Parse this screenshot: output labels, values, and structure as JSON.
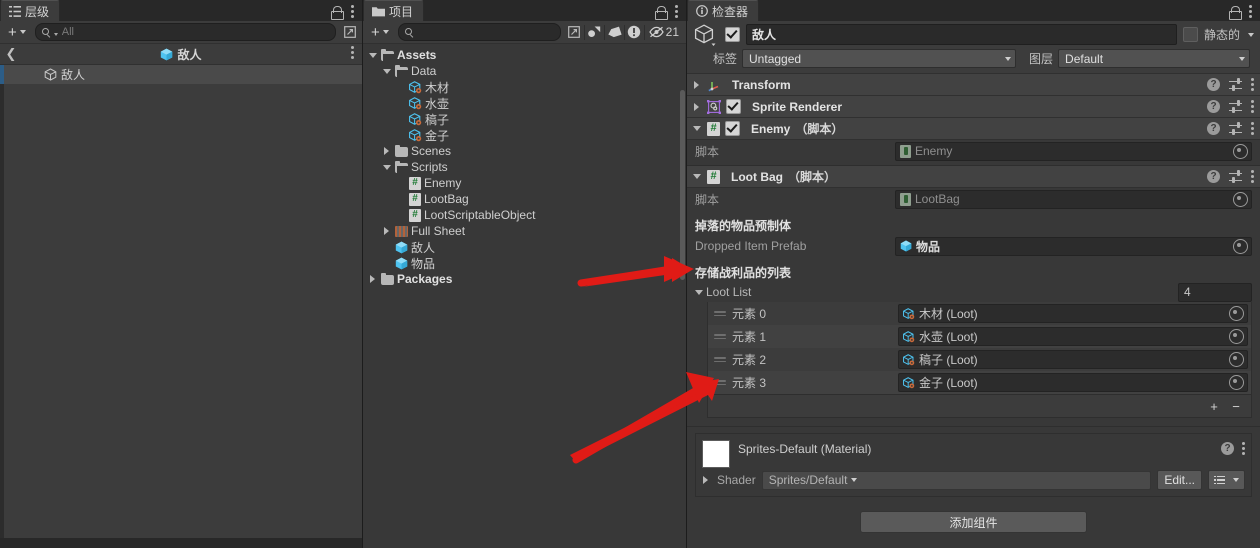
{
  "colors": {
    "accent_blue": "#4ec3f0",
    "panel_bg": "#383838",
    "header_bg": "#424242",
    "selection": "#2c5d87",
    "arrow_red": "#e01b16",
    "script_green": "#1d7a33"
  },
  "hierarchy": {
    "tab_label": "层级",
    "tab_icon": "hierarchy-icon",
    "add_label": "+",
    "search_placeholder": "All",
    "breadcrumb_title": "敌人",
    "rows": [
      {
        "label": "敌人",
        "icon": "gameobject-outline-icon",
        "selected": true
      }
    ]
  },
  "project": {
    "tab_label": "项目",
    "tab_icon": "folder-icon",
    "add_label": "+",
    "search_placeholder": "",
    "toolbar_icons": [
      "type-filter-icon",
      "label-filter-icon",
      "warning-filter-icon",
      "hidden-count-icon"
    ],
    "hidden_count": "21",
    "tree": [
      {
        "label": "Assets",
        "indent": 0,
        "twisty": "down",
        "icon": "folder-open-icon",
        "bold": true
      },
      {
        "label": "Data",
        "indent": 1,
        "twisty": "down",
        "icon": "folder-open-icon",
        "bold": false
      },
      {
        "label": "木材",
        "indent": 2,
        "twisty": "none",
        "icon": "scriptable-object-icon",
        "bold": false
      },
      {
        "label": "水壶",
        "indent": 2,
        "twisty": "none",
        "icon": "scriptable-object-icon",
        "bold": false
      },
      {
        "label": "稿子",
        "indent": 2,
        "twisty": "none",
        "icon": "scriptable-object-icon",
        "bold": false
      },
      {
        "label": "金子",
        "indent": 2,
        "twisty": "none",
        "icon": "scriptable-object-icon",
        "bold": false
      },
      {
        "label": "Scenes",
        "indent": 1,
        "twisty": "right",
        "icon": "folder-icon",
        "bold": false
      },
      {
        "label": "Scripts",
        "indent": 1,
        "twisty": "down",
        "icon": "folder-open-icon",
        "bold": false
      },
      {
        "label": "Enemy",
        "indent": 2,
        "twisty": "none",
        "icon": "csharp-script-icon",
        "bold": false
      },
      {
        "label": "LootBag",
        "indent": 2,
        "twisty": "none",
        "icon": "csharp-script-icon",
        "bold": false
      },
      {
        "label": "LootScriptableObject",
        "indent": 2,
        "twisty": "none",
        "icon": "csharp-script-icon",
        "bold": false
      },
      {
        "label": "Full Sheet",
        "indent": 1,
        "twisty": "right",
        "icon": "sprite-sheet-icon",
        "bold": false
      },
      {
        "label": "敌人",
        "indent": 1,
        "twisty": "none",
        "icon": "prefab-icon",
        "bold": false
      },
      {
        "label": "物品",
        "indent": 1,
        "twisty": "none",
        "icon": "prefab-icon",
        "bold": false
      },
      {
        "label": "Packages",
        "indent": 0,
        "twisty": "right",
        "icon": "folder-icon",
        "bold": true
      }
    ]
  },
  "inspector": {
    "tab_label": "检查器",
    "tab_icon": "info-icon",
    "object_name": "敌人",
    "object_enabled": true,
    "static_label": "静态的",
    "static_checked": false,
    "tag_label": "标签",
    "tag_value": "Untagged",
    "layer_label": "图层",
    "layer_value": "Default",
    "components": [
      {
        "title": "Transform",
        "suffix": "",
        "icon": "transform-icon",
        "has_checkbox": false,
        "expanded": false
      },
      {
        "title": "Sprite Renderer",
        "suffix": "",
        "icon": "sprite-renderer-icon",
        "has_checkbox": true,
        "checked": true,
        "expanded": false
      },
      {
        "title": "Enemy",
        "suffix": "（脚本）",
        "icon": "script-icon",
        "has_checkbox": true,
        "checked": true,
        "expanded": true
      },
      {
        "title": "Loot Bag",
        "suffix": "（脚本）",
        "icon": "script-icon",
        "has_checkbox": false,
        "expanded": true
      }
    ],
    "enemy_script_row": {
      "label": "脚本",
      "value": "Enemy"
    },
    "lootbag_script_row": {
      "label": "脚本",
      "value": "LootBag"
    },
    "dropped_item_header": "掉落的物品预制体",
    "dropped_item_label": "Dropped Item Prefab",
    "dropped_item_value": "物品",
    "loot_list_header": "存储战利品的列表",
    "loot_list_label": "Loot List",
    "loot_list_size": "4",
    "loot_elements": [
      {
        "label": "元素 0",
        "value": "木材 (Loot)"
      },
      {
        "label": "元素 1",
        "value": "水壶 (Loot)"
      },
      {
        "label": "元素 2",
        "value": "稿子 (Loot)"
      },
      {
        "label": "元素 3",
        "value": "金子 (Loot)"
      }
    ],
    "list_add_label": "+",
    "list_remove_label": "−",
    "material": {
      "title": "Sprites-Default (Material)",
      "shader_label": "Shader",
      "shader_value": "Sprites/Default",
      "edit_label": "Edit..."
    },
    "add_component_label": "添加组件"
  }
}
